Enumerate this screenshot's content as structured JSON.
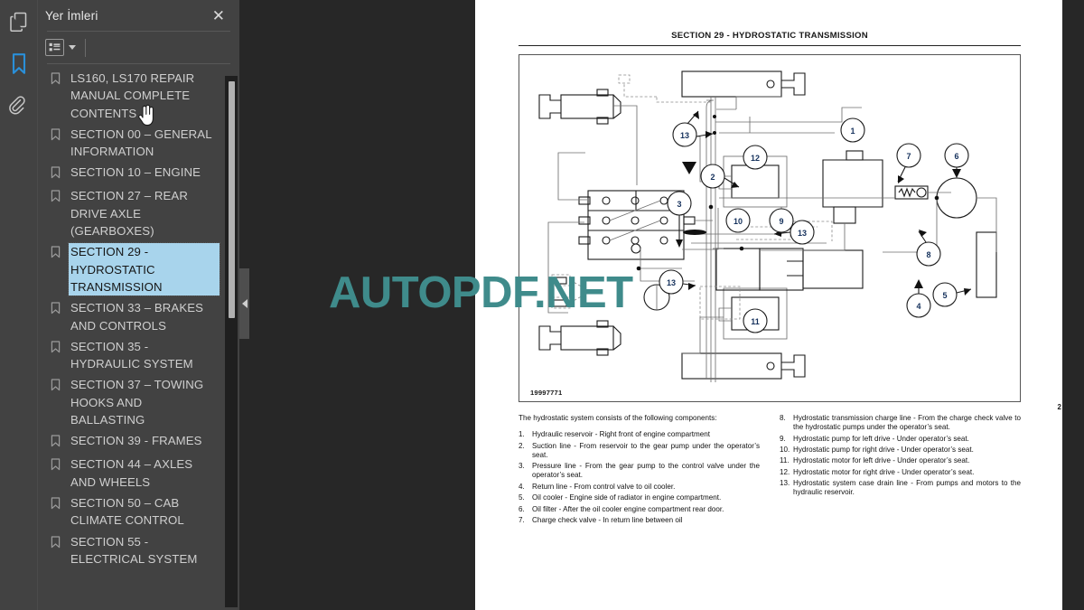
{
  "app": {
    "panel_title": "Yer İmleri",
    "close_label": "✕"
  },
  "rail": {
    "items": [
      {
        "icon": "pages-thumbnail-icon",
        "label": "Sayfa Küçük Resimleri",
        "active": false
      },
      {
        "icon": "bookmark-icon",
        "label": "Yer İmleri",
        "active": true
      },
      {
        "icon": "paperclip-icon",
        "label": "Ekler",
        "active": false
      }
    ]
  },
  "toolbar": {
    "options_icon": "list-options-icon",
    "options_label": "Seçenekler"
  },
  "bookmarks": {
    "items": [
      {
        "label": "LS160, LS170 REPAIR MANUAL COMPLETE CONTENTS",
        "selected": false
      },
      {
        "label": "SECTION 00 – GENERAL INFORMATION",
        "selected": false
      },
      {
        "label": "SECTION 10 – ENGINE",
        "selected": false
      },
      {
        "label": "SECTION 27 – REAR DRIVE AXLE (GEARBOXES)",
        "selected": false
      },
      {
        "label": "SECTION 29 - HYDROSTATIC TRANSMISSION",
        "selected": true
      },
      {
        "label": "SECTION 33 – BRAKES AND CONTROLS",
        "selected": false
      },
      {
        "label": "SECTION 35 - HYDRAULIC SYSTEM",
        "selected": false
      },
      {
        "label": "SECTION 37 – TOWING HOOKS AND BALLASTING",
        "selected": false
      },
      {
        "label": "SECTION 39 - FRAMES",
        "selected": false
      },
      {
        "label": "SECTION 44 – AXLES AND WHEELS",
        "selected": false
      },
      {
        "label": "SECTION 50 – CAB CLIMATE CONTROL",
        "selected": false
      },
      {
        "label": "SECTION 55 - ELECTRICAL SYSTEM",
        "selected": false
      }
    ]
  },
  "document": {
    "header": "SECTION 29 - HYDROSTATIC TRANSMISSION",
    "figure_number": "19997771",
    "page_number": "2",
    "intro": "The hydrostatic system consists of the following components:",
    "left_items": [
      {
        "idx": "1.",
        "text": "Hydraulic reservoir - Right front of engine compartment"
      },
      {
        "idx": "2.",
        "text": "Suction line - From reservoir to the gear pump under the operator’s seat."
      },
      {
        "idx": "3.",
        "text": "Pressure line - From the gear pump to the control valve under the operator’s seat."
      },
      {
        "idx": "4.",
        "text": "Return line - From control valve to oil cooler."
      },
      {
        "idx": "5.",
        "text": "Oil cooler - Engine side of radiator in engine compartment."
      },
      {
        "idx": "6.",
        "text": "Oil filter - After the oil cooler engine compartment rear door."
      },
      {
        "idx": "7.",
        "text": "Charge check valve - In return line between oil"
      }
    ],
    "right_items": [
      {
        "idx": "8.",
        "text": "Hydrostatic transmission charge line - From the charge check valve to the hydrostatic pumps under the operator’s seat."
      },
      {
        "idx": "9.",
        "text": "Hydrostatic pump for left drive - Under operator’s seat."
      },
      {
        "idx": "10.",
        "text": "Hydrostatic pump for right drive - Under operator’s seat."
      },
      {
        "idx": "11.",
        "text": "Hydrostatic motor for left drive - Under operator’s seat."
      },
      {
        "idx": "12.",
        "text": "Hydrostatic motor for right drive - Under operator’s seat."
      },
      {
        "idx": "13.",
        "text": "Hydrostatic system case drain line - From pumps and motors to the hydraulic reservoir."
      }
    ],
    "callouts": [
      "1",
      "2",
      "3",
      "4",
      "5",
      "6",
      "7",
      "8",
      "9",
      "10",
      "11",
      "12",
      "13",
      "13",
      "13"
    ]
  },
  "watermark": {
    "text": "AUTOPDF.NET",
    "color": "#3f8b8b"
  },
  "colors": {
    "panel_bg": "#424242",
    "viewer_bg": "#272727",
    "selection": "#a8d4ec",
    "accent": "#2a8fd8"
  }
}
